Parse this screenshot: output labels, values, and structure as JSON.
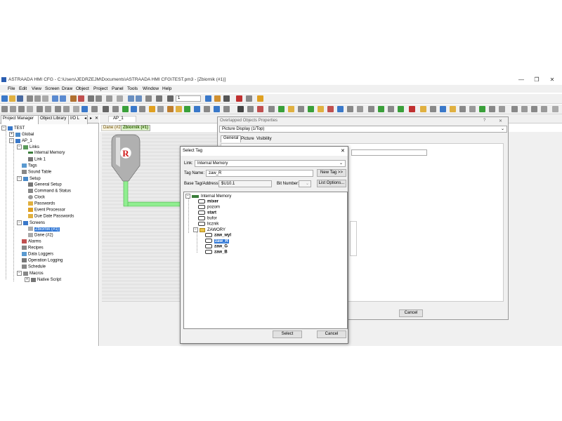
{
  "window": {
    "title": "ASTRAADA HMI CFG - C:\\Users\\JEDRZEJM\\Documents\\ASTRAADA HMI CFG\\TEST.pm3 - [Zbiornik (#1)]",
    "controls": [
      "—",
      "❐",
      "✕"
    ]
  },
  "menu": [
    "File",
    "Edit",
    "View",
    "Screen",
    "Draw",
    "Object",
    "Project",
    "Panel",
    "Tools",
    "Window",
    "Help"
  ],
  "toolbar": {
    "zoom_value": "1"
  },
  "project_manager": {
    "title": "Project Manager",
    "tabs": [
      "Project Manager",
      "Object Library",
      "I/O L"
    ],
    "tree": [
      {
        "label": "TEST"
      },
      {
        "label": "Global"
      },
      {
        "label": "AP_1"
      },
      {
        "label": "Links"
      },
      {
        "label": "Internal Memory"
      },
      {
        "label": "Link 1"
      },
      {
        "label": "Tags"
      },
      {
        "label": "Sound Table"
      },
      {
        "label": "Setup"
      },
      {
        "label": "General Setup"
      },
      {
        "label": "Command & Status"
      },
      {
        "label": "Clock"
      },
      {
        "label": "Passwords"
      },
      {
        "label": "Event Processor"
      },
      {
        "label": "Due Date Passwords"
      },
      {
        "label": "Screens"
      },
      {
        "label": "Zbiornik (#1)"
      },
      {
        "label": "Dane (#2)"
      },
      {
        "label": "Alarms"
      },
      {
        "label": "Recipes"
      },
      {
        "label": "Data Loggers"
      },
      {
        "label": "Operation Logging"
      },
      {
        "label": "Schedule"
      },
      {
        "label": "Macros"
      },
      {
        "label": "Native Script"
      }
    ]
  },
  "editor": {
    "doc_tab": "AP_1",
    "screen_tabs": [
      "Dane (#2)",
      "Zbiornik (#1)"
    ],
    "tank_label": "R"
  },
  "overlapped_dialog": {
    "title": "Overlapped Objects Properties",
    "help": "?",
    "close": "✕",
    "combo_value": "Picture Display (1/Top)",
    "tabs": [
      "General",
      "Picture",
      "Visibility"
    ],
    "cancel_label": "Cancel"
  },
  "select_tag_dialog": {
    "title": "Select Tag",
    "close": "✕",
    "link_label": "Link:",
    "link_value": "Internal Memory",
    "tag_name_label": "Tag Name:",
    "tag_name_value": "zaw_R",
    "new_tag_label": "New Tag >>",
    "base_label": "Base Tag/Address:",
    "base_value": "$U10.1",
    "bit_label": "Bit Number:",
    "list_options_label": "List Options...",
    "tree": {
      "root": "Internal Memory",
      "tags": [
        "mixer",
        "pozom",
        "start",
        "bufor",
        "licznik"
      ],
      "folder": "ZAWORY",
      "folder_tags": [
        "zaw_wyl",
        "zaw_R",
        "zaw_G",
        "zaw_B"
      ],
      "selected": "zaw_R"
    },
    "select_label": "Select",
    "cancel_label": "Cancel"
  },
  "colors": {
    "selection": "#3178d6",
    "pipe": "#90ee90",
    "tank": "#b0b0b0",
    "tank_label": "#d11d1d"
  }
}
